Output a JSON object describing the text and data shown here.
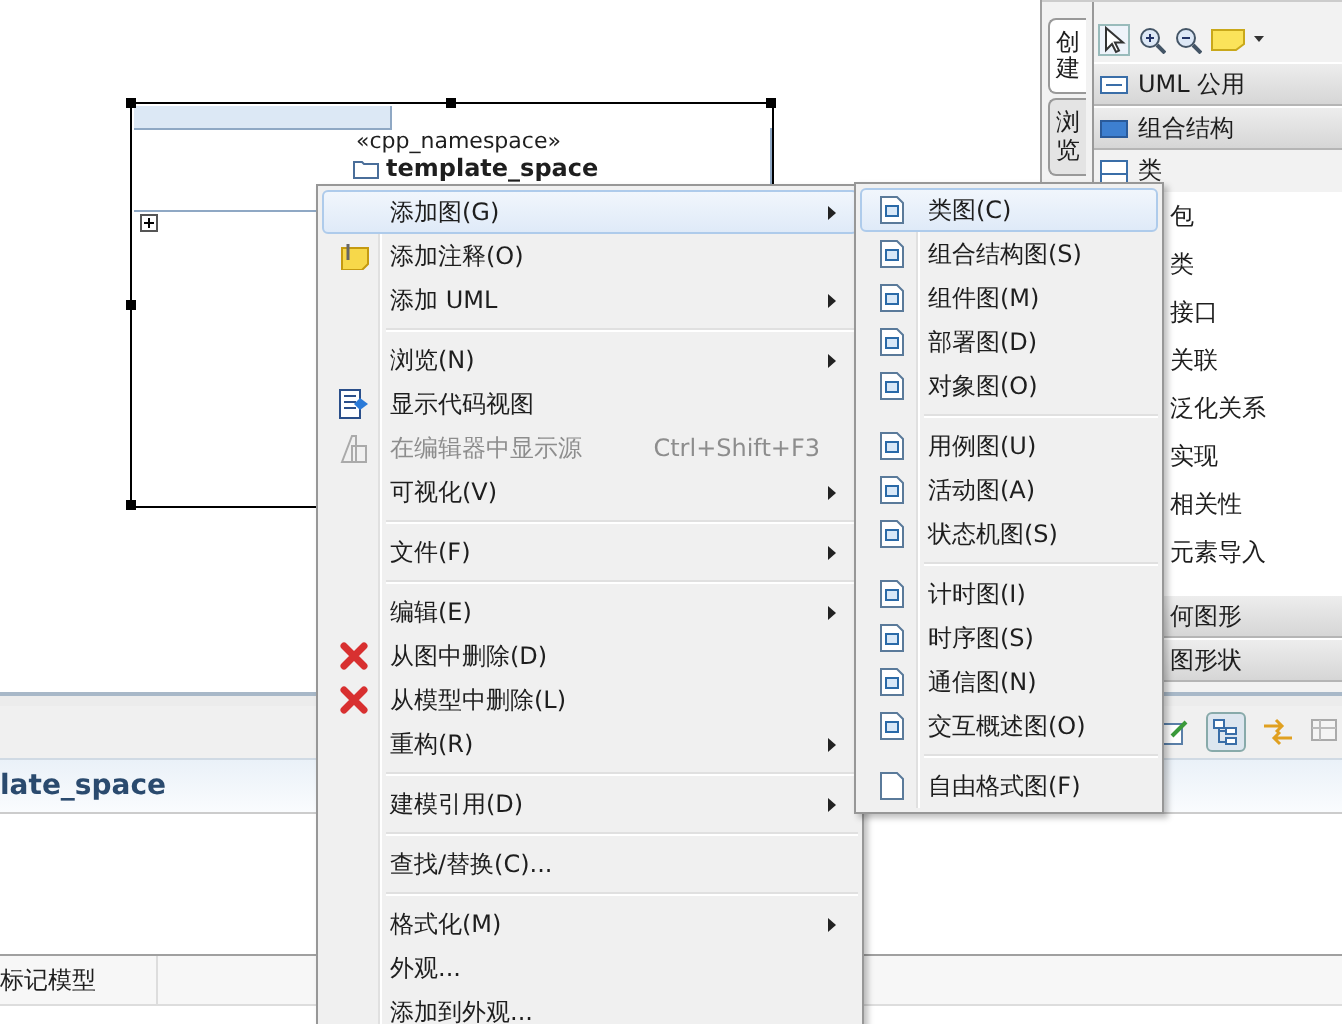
{
  "editor": {
    "shape": {
      "stereotype": "«cpp_namespace»",
      "name": "template_space"
    }
  },
  "palette": {
    "tabs": [
      {
        "label": "创建",
        "selected": true
      },
      {
        "label": "浏览",
        "selected": false
      }
    ],
    "drawers": [
      {
        "label": "UML 公用",
        "expanded": false
      },
      {
        "label": "组合结构",
        "expanded": true,
        "stack": "类",
        "items": [
          "包",
          "类",
          "接口",
          "关联",
          "泛化关系",
          "实现",
          "相关性",
          "元素导入"
        ]
      },
      {
        "label": "何图形",
        "expanded": false
      },
      {
        "label": "图形状",
        "expanded": false
      }
    ]
  },
  "properties": {
    "title": "late_space",
    "table_header": "标记模型"
  },
  "context_menu": {
    "items": [
      {
        "kind": "item",
        "label": "添加图(G)",
        "selected": true,
        "disabled": false,
        "submenu": true
      },
      {
        "kind": "item",
        "label": "添加注释(O)",
        "selected": false,
        "disabled": false,
        "submenu": false
      },
      {
        "kind": "item",
        "label": "添加 UML",
        "selected": false,
        "disabled": false,
        "submenu": true
      },
      {
        "kind": "separator"
      },
      {
        "kind": "item",
        "label": "浏览(N)",
        "selected": false,
        "disabled": false,
        "submenu": true
      },
      {
        "kind": "item",
        "label": "显示代码视图",
        "selected": false,
        "disabled": false,
        "submenu": false
      },
      {
        "kind": "item",
        "label": "在编辑器中显示源",
        "shortcut": "Ctrl+Shift+F3",
        "selected": false,
        "disabled": true,
        "submenu": false
      },
      {
        "kind": "item",
        "label": "可视化(V)",
        "selected": false,
        "disabled": false,
        "submenu": true
      },
      {
        "kind": "separator"
      },
      {
        "kind": "item",
        "label": "文件(F)",
        "selected": false,
        "disabled": false,
        "submenu": true
      },
      {
        "kind": "separator"
      },
      {
        "kind": "item",
        "label": "编辑(E)",
        "selected": false,
        "disabled": false,
        "submenu": true
      },
      {
        "kind": "item",
        "label": "从图中删除(D)",
        "selected": false,
        "disabled": false,
        "submenu": false
      },
      {
        "kind": "item",
        "label": "从模型中删除(L)",
        "selected": false,
        "disabled": false,
        "submenu": false
      },
      {
        "kind": "item",
        "label": "重构(R)",
        "selected": false,
        "disabled": false,
        "submenu": true
      },
      {
        "kind": "separator"
      },
      {
        "kind": "item",
        "label": "建模引用(D)",
        "selected": false,
        "disabled": false,
        "submenu": true
      },
      {
        "kind": "separator"
      },
      {
        "kind": "item",
        "label": "查找/替换(C)...",
        "selected": false,
        "disabled": false,
        "submenu": false
      },
      {
        "kind": "separator"
      },
      {
        "kind": "item",
        "label": "格式化(M)",
        "selected": false,
        "disabled": false,
        "submenu": true
      },
      {
        "kind": "item",
        "label": "外观...",
        "selected": false,
        "disabled": false,
        "submenu": false
      },
      {
        "kind": "item",
        "label": "添加到外观...",
        "selected": false,
        "disabled": false,
        "submenu": false
      }
    ]
  },
  "submenu": {
    "items": [
      {
        "kind": "item",
        "label": "类图(C)",
        "selected": true
      },
      {
        "kind": "item",
        "label": "组合结构图(S)",
        "selected": false
      },
      {
        "kind": "item",
        "label": "组件图(M)",
        "selected": false
      },
      {
        "kind": "item",
        "label": "部署图(D)",
        "selected": false
      },
      {
        "kind": "item",
        "label": "对象图(O)",
        "selected": false
      },
      {
        "kind": "separator"
      },
      {
        "kind": "item",
        "label": "用例图(U)",
        "selected": false
      },
      {
        "kind": "item",
        "label": "活动图(A)",
        "selected": false
      },
      {
        "kind": "item",
        "label": "状态机图(S)",
        "selected": false
      },
      {
        "kind": "separator"
      },
      {
        "kind": "item",
        "label": "计时图(I)",
        "selected": false
      },
      {
        "kind": "item",
        "label": "时序图(S)",
        "selected": false
      },
      {
        "kind": "item",
        "label": "通信图(N)",
        "selected": false
      },
      {
        "kind": "item",
        "label": "交互概述图(O)",
        "selected": false
      },
      {
        "kind": "separator"
      },
      {
        "kind": "item",
        "label": "自由格式图(F)",
        "selected": false
      }
    ]
  }
}
